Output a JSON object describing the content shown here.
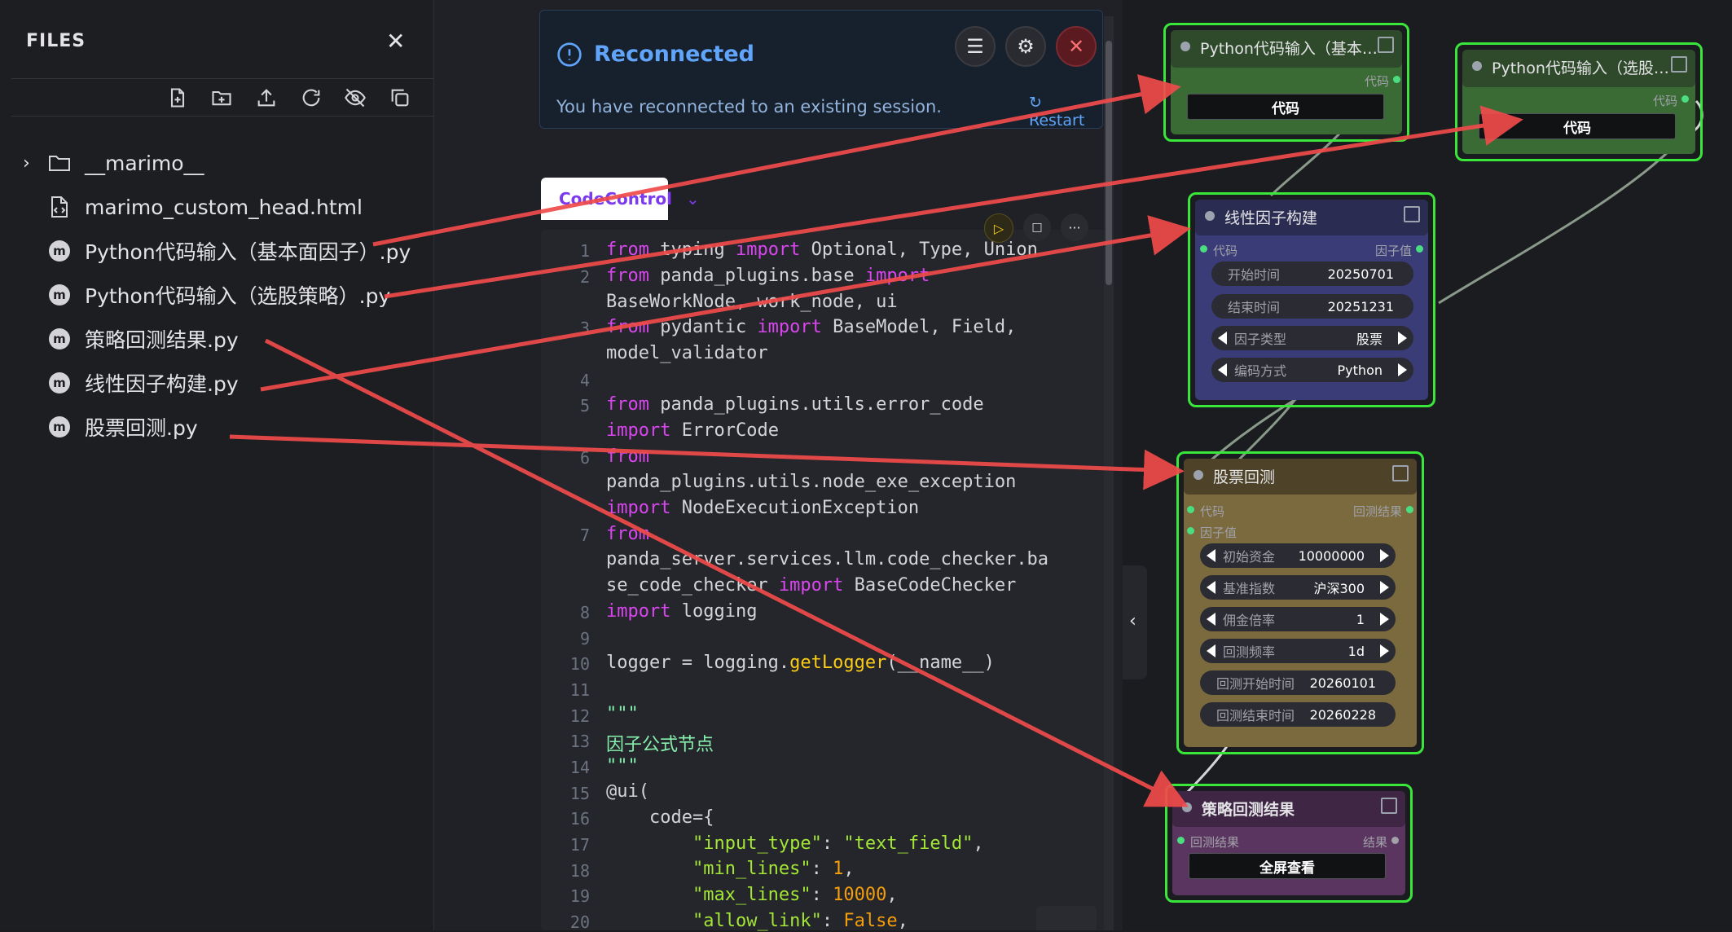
{
  "sidebar": {
    "title": "FILES",
    "close_icon": "close-icon",
    "toolbar_icons": [
      "new-file-icon",
      "new-folder-icon",
      "upload-icon",
      "refresh-icon",
      "hide-icon",
      "copy-icon"
    ],
    "files": [
      {
        "name": "__marimo__",
        "icon": "folder-icon"
      },
      {
        "name": "marimo_custom_head.html",
        "icon": "html-file-icon"
      },
      {
        "name": "Python代码输入（基本面因子）.py",
        "icon": "marimo-icon"
      },
      {
        "name": "Python代码输入（选股策略）.py",
        "icon": "marimo-icon"
      },
      {
        "name": "策略回测结果.py",
        "icon": "marimo-icon"
      },
      {
        "name": "线性因子构建.py",
        "icon": "marimo-icon"
      },
      {
        "name": "股票回测.py",
        "icon": "marimo-icon"
      }
    ]
  },
  "toast": {
    "title": "Reconnected",
    "message": "You have reconnected to an existing session.",
    "restart": "Restart"
  },
  "editor": {
    "tab": "CodeControl",
    "line_numbers": [
      "1",
      "2",
      "3",
      "4",
      "5",
      "6",
      "7",
      "8",
      "9",
      "10",
      "11",
      "12",
      "13",
      "14",
      "15",
      "16",
      "17",
      "18",
      "19",
      "20"
    ]
  },
  "canvas": {
    "node1": {
      "title": "Python代码输入（基本…",
      "port_out": "代码",
      "button": "代码"
    },
    "node2": {
      "title": "Python代码输入（选股…",
      "port_out": "代码",
      "button": "代码"
    },
    "node3": {
      "title": "线性因子构建",
      "port_in": "代码",
      "port_out": "因子值",
      "fields": [
        {
          "label": "开始时间",
          "value": "20250701"
        },
        {
          "label": "结束时间",
          "value": "20251231"
        },
        {
          "label": "因子类型",
          "value": "股票"
        },
        {
          "label": "编码方式",
          "value": "Python"
        }
      ]
    },
    "node4": {
      "title": "股票回测",
      "port_in1": "代码",
      "port_in2": "因子值",
      "port_out": "回测结果",
      "fields": [
        {
          "label": "初始资金",
          "value": "10000000"
        },
        {
          "label": "基准指数",
          "value": "沪深300"
        },
        {
          "label": "佣金倍率",
          "value": "1"
        },
        {
          "label": "回测频率",
          "value": "1d"
        },
        {
          "label": "回测开始时间",
          "value": "20260101"
        },
        {
          "label": "回测结束时间",
          "value": "20260228"
        }
      ]
    },
    "node5": {
      "title": "策略回测结果",
      "port_in": "回测结果",
      "port_out": "结果",
      "button": "全屏查看"
    }
  },
  "colors": {
    "node_border": "#39e639",
    "arrow": "#f04b4b",
    "accent": "#60a5fa"
  }
}
